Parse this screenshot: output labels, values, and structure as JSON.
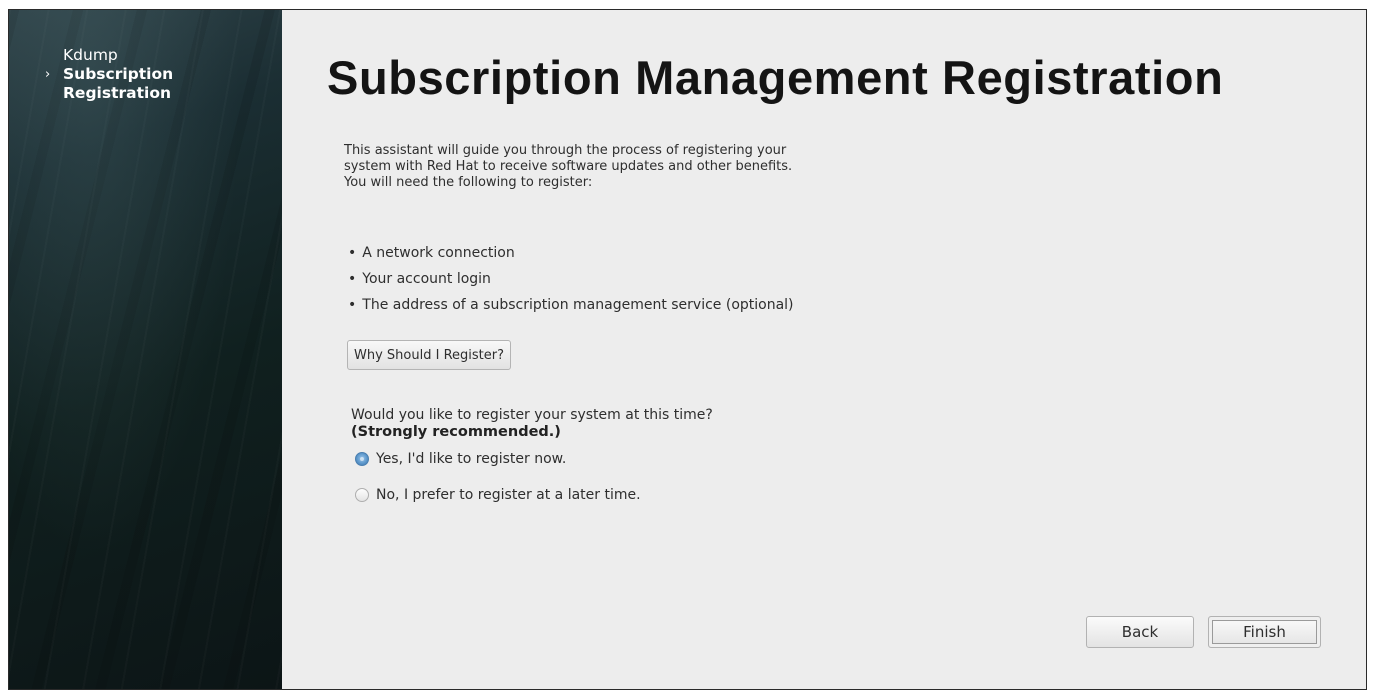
{
  "sidebar": {
    "steps": [
      {
        "label": "Kdump",
        "active": false
      },
      {
        "label": "Subscription\nRegistration",
        "active": true
      }
    ],
    "current_marker": "›"
  },
  "main": {
    "title": "Subscription Management Registration",
    "intro": "This assistant will guide you through the process of registering your system with Red Hat to receive software updates and other benefits. You will need the following to register:",
    "requirements": [
      "A network connection",
      "Your account login",
      "The address of a subscription management service (optional)"
    ],
    "bullet": "•",
    "why_button_label": "Why Should I Register?",
    "question": {
      "text": "Would you like to register your system at this time?",
      "emphasis": "(Strongly recommended.)"
    },
    "options": [
      {
        "label": "Yes, I'd like to register now.",
        "selected": true
      },
      {
        "label": "No, I prefer to register at a later time.",
        "selected": false
      }
    ]
  },
  "footer": {
    "back_label": "Back",
    "finish_label": "Finish"
  },
  "colors": {
    "sidebar_dark": "#10201f",
    "content_bg": "#ededed",
    "radio_selected": "#5d98cc"
  }
}
